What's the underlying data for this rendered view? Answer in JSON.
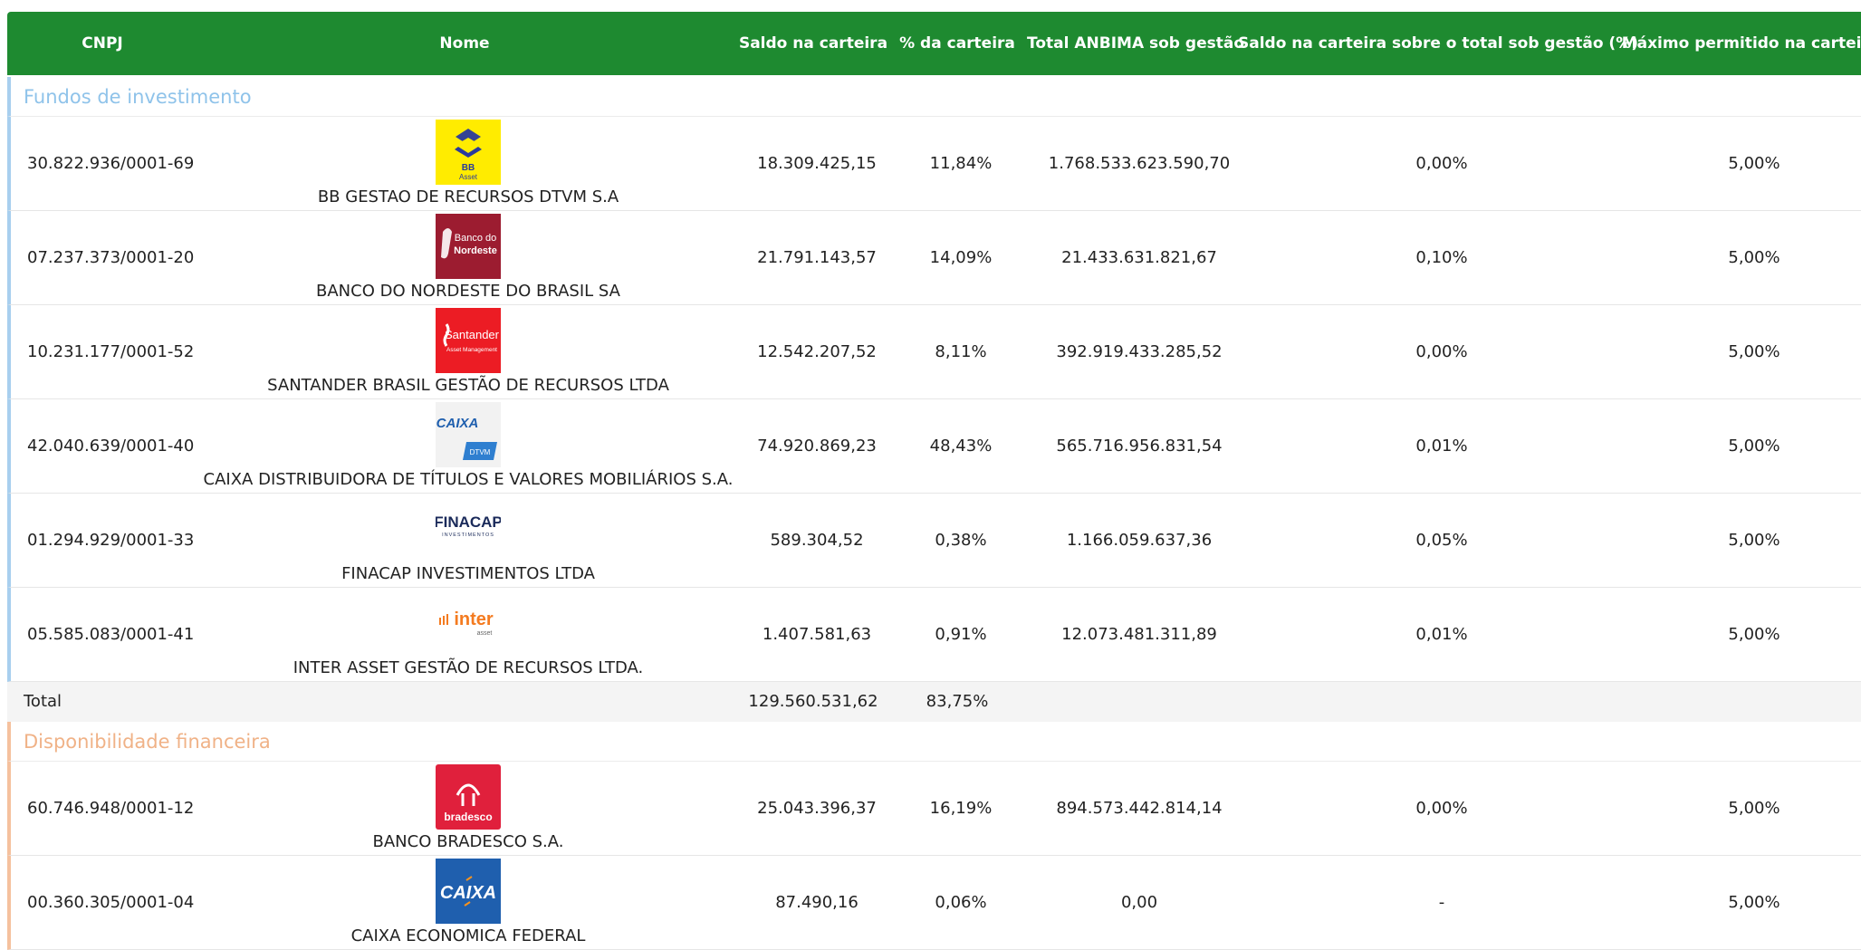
{
  "headers": {
    "cnpj": "CNPJ",
    "nome": "Nome",
    "saldo": "Saldo na carteira",
    "pct": "% da carteira",
    "total_anbima": "Total ANBIMA sob gestão",
    "saldo_sobre_total": "Saldo na carteira sobre o total sob gestão (%)",
    "maximo": "Máximo permitido na carteira"
  },
  "sections": [
    {
      "title": "Fundos de investimento",
      "rows": [
        {
          "cnpj": "30.822.936/0001-69",
          "nome": "BB GESTAO DE RECURSOS DTVM S.A",
          "logo": "bb-asset",
          "saldo": "18.309.425,15",
          "pct": "11,84%",
          "total_anbima": "1.768.533.623.590,70",
          "saldo_sobre_total": "0,00%",
          "maximo": "5,00%"
        },
        {
          "cnpj": "07.237.373/0001-20",
          "nome": "BANCO DO NORDESTE DO BRASIL SA",
          "logo": "banco-do-nordeste",
          "saldo": "21.791.143,57",
          "pct": "14,09%",
          "total_anbima": "21.433.631.821,67",
          "saldo_sobre_total": "0,10%",
          "maximo": "5,00%"
        },
        {
          "cnpj": "10.231.177/0001-52",
          "nome": "SANTANDER BRASIL GESTÃO DE RECURSOS LTDA",
          "logo": "santander",
          "saldo": "12.542.207,52",
          "pct": "8,11%",
          "total_anbima": "392.919.433.285,52",
          "saldo_sobre_total": "0,00%",
          "maximo": "5,00%"
        },
        {
          "cnpj": "42.040.639/0001-40",
          "nome": "CAIXA DISTRIBUIDORA DE TÍTULOS E VALORES MOBILIÁRIOS S.A.",
          "logo": "caixa-dtvm",
          "saldo": "74.920.869,23",
          "pct": "48,43%",
          "total_anbima": "565.716.956.831,54",
          "saldo_sobre_total": "0,01%",
          "maximo": "5,00%"
        },
        {
          "cnpj": "01.294.929/0001-33",
          "nome": "FINACAP INVESTIMENTOS LTDA",
          "logo": "finacap",
          "saldo": "589.304,52",
          "pct": "0,38%",
          "total_anbima": "1.166.059.637,36",
          "saldo_sobre_total": "0,05%",
          "maximo": "5,00%"
        },
        {
          "cnpj": "05.585.083/0001-41",
          "nome": "INTER ASSET GESTÃO DE RECURSOS LTDA.",
          "logo": "inter-asset",
          "saldo": "1.407.581,63",
          "pct": "0,91%",
          "total_anbima": "12.073.481.311,89",
          "saldo_sobre_total": "0,01%",
          "maximo": "5,00%"
        }
      ],
      "total": {
        "label": "Total",
        "saldo": "129.560.531,62",
        "pct": "83,75%"
      }
    },
    {
      "title": "Disponibilidade financeira",
      "rows": [
        {
          "cnpj": "60.746.948/0001-12",
          "nome": "BANCO BRADESCO S.A.",
          "logo": "bradesco",
          "saldo": "25.043.396,37",
          "pct": "16,19%",
          "total_anbima": "894.573.442.814,14",
          "saldo_sobre_total": "0,00%",
          "maximo": "5,00%"
        },
        {
          "cnpj": "00.360.305/0001-04",
          "nome": "CAIXA ECONOMICA FEDERAL",
          "logo": "caixa",
          "saldo": "87.490,16",
          "pct": "0,06%",
          "total_anbima": "0,00",
          "saldo_sobre_total": "-",
          "maximo": "5,00%"
        }
      ]
    }
  ],
  "logos": {
    "bb_asset": {
      "line1": "BB",
      "line2": "Asset"
    },
    "banco_do_nordeste": {
      "line1": "Banco do",
      "line2": "Nordeste"
    },
    "santander": {
      "line1": "Santander",
      "line2": "Asset Management"
    },
    "caixa_dtvm": {
      "line1": "CAIXA",
      "line2": "DTVM"
    },
    "finacap": {
      "line1": "FINACAP",
      "line2": "INVESTIMENTOS"
    },
    "inter_asset": {
      "line1": "inter",
      "line2": "asset"
    },
    "bradesco": {
      "line1": "bradesco"
    },
    "caixa": {
      "line1": "CAIXA"
    }
  },
  "colors": {
    "header_bg": "#1e8a30",
    "section_fundos": "#8fc3ea",
    "section_disponibilidade": "#f0b287"
  }
}
